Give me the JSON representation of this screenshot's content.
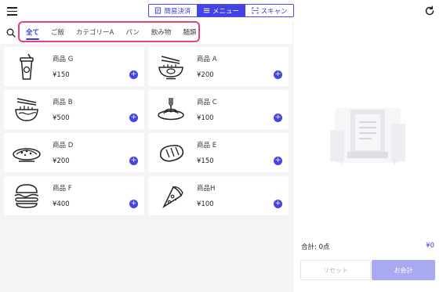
{
  "header": {
    "tabs": [
      {
        "label": "簡易決済",
        "icon": "receipt-icon",
        "active": false
      },
      {
        "label": "メニュー",
        "icon": "list-icon",
        "active": true
      },
      {
        "label": "スキャン",
        "icon": "scan-icon",
        "active": false
      }
    ]
  },
  "categories": [
    "全て",
    "ご飯",
    "カテゴリーA",
    "パン",
    "飲み物",
    "麺類"
  ],
  "active_category": "全て",
  "products": [
    {
      "name": "商品 G",
      "price": "¥150",
      "icon": "drink-cup-icon"
    },
    {
      "name": "商品 A",
      "price": "¥200",
      "icon": "noodle-bowl-icon"
    },
    {
      "name": "商品 B",
      "price": "¥500",
      "icon": "ramen-bowl-icon"
    },
    {
      "name": "商品 C",
      "price": "¥100",
      "icon": "pasta-plate-icon"
    },
    {
      "name": "商品 D",
      "price": "¥200",
      "icon": "pizza-plate-icon"
    },
    {
      "name": "商品 E",
      "price": "¥150",
      "icon": "bread-icon"
    },
    {
      "name": "商品 F",
      "price": "¥400",
      "icon": "burger-icon"
    },
    {
      "name": "商品H",
      "price": "¥100",
      "icon": "pizza-slice-icon"
    }
  ],
  "cart": {
    "total_label": "合計: 0点",
    "total_value": "¥0",
    "reset_label": "リセット",
    "pay_label": "お会計"
  },
  "colors": {
    "accent": "#4343e6",
    "highlight_border": "#e8407a",
    "pay_disabled": "#a9a9f0"
  }
}
